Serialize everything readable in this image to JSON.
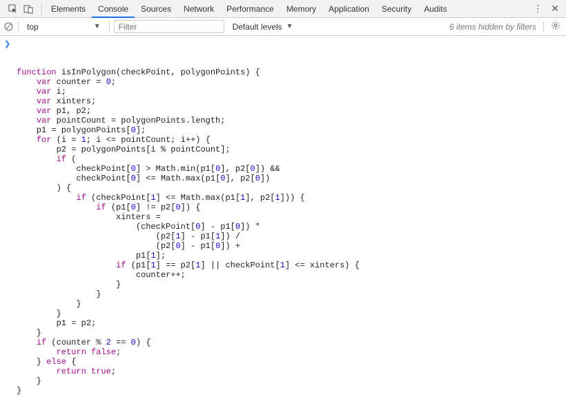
{
  "tabs": {
    "items": [
      {
        "label": "Elements"
      },
      {
        "label": "Console"
      },
      {
        "label": "Sources"
      },
      {
        "label": "Network"
      },
      {
        "label": "Performance"
      },
      {
        "label": "Memory"
      },
      {
        "label": "Application"
      },
      {
        "label": "Security"
      },
      {
        "label": "Audits"
      }
    ],
    "activeIndex": 1
  },
  "filterBar": {
    "context": "top",
    "filterPlaceholder": "Filter",
    "levels": "Default levels",
    "hidden": "6 items hidden by filters"
  },
  "code": {
    "lines": [
      [
        [
          "kw",
          "function"
        ],
        [
          "pun",
          " "
        ],
        [
          "fn",
          "isInPolygon"
        ],
        [
          "pun",
          "("
        ],
        [
          "fn",
          "checkPoint"
        ],
        [
          "pun",
          ", "
        ],
        [
          "fn",
          "polygonPoints"
        ],
        [
          "pun",
          ") {"
        ]
      ],
      [
        [
          "pun",
          "    "
        ],
        [
          "kw",
          "var"
        ],
        [
          "pun",
          " counter = "
        ],
        [
          "num",
          "0"
        ],
        [
          "pun",
          ";"
        ]
      ],
      [
        [
          "pun",
          "    "
        ],
        [
          "kw",
          "var"
        ],
        [
          "pun",
          " i;"
        ]
      ],
      [
        [
          "pun",
          "    "
        ],
        [
          "kw",
          "var"
        ],
        [
          "pun",
          " xinters;"
        ]
      ],
      [
        [
          "pun",
          "    "
        ],
        [
          "kw",
          "var"
        ],
        [
          "pun",
          " p1, p2;"
        ]
      ],
      [
        [
          "pun",
          "    "
        ],
        [
          "kw",
          "var"
        ],
        [
          "pun",
          " pointCount = polygonPoints.length;"
        ]
      ],
      [
        [
          "pun",
          "    p1 = polygonPoints["
        ],
        [
          "num",
          "0"
        ],
        [
          "pun",
          "];"
        ]
      ],
      [
        [
          "pun",
          ""
        ]
      ],
      [
        [
          "pun",
          "    "
        ],
        [
          "kw",
          "for"
        ],
        [
          "pun",
          " (i = "
        ],
        [
          "num",
          "1"
        ],
        [
          "pun",
          "; i <= pointCount; i++) {"
        ]
      ],
      [
        [
          "pun",
          "        p2 = polygonPoints[i % pointCount];"
        ]
      ],
      [
        [
          "pun",
          "        "
        ],
        [
          "kw",
          "if"
        ],
        [
          "pun",
          " ("
        ]
      ],
      [
        [
          "pun",
          "            checkPoint["
        ],
        [
          "num",
          "0"
        ],
        [
          "pun",
          "] > Math.min(p1["
        ],
        [
          "num",
          "0"
        ],
        [
          "pun",
          "], p2["
        ],
        [
          "num",
          "0"
        ],
        [
          "pun",
          "]) &&"
        ]
      ],
      [
        [
          "pun",
          "            checkPoint["
        ],
        [
          "num",
          "0"
        ],
        [
          "pun",
          "] <= Math.max(p1["
        ],
        [
          "num",
          "0"
        ],
        [
          "pun",
          "], p2["
        ],
        [
          "num",
          "0"
        ],
        [
          "pun",
          "])"
        ]
      ],
      [
        [
          "pun",
          "        ) {"
        ]
      ],
      [
        [
          "pun",
          "            "
        ],
        [
          "kw",
          "if"
        ],
        [
          "pun",
          " (checkPoint["
        ],
        [
          "num",
          "1"
        ],
        [
          "pun",
          "] <= Math.max(p1["
        ],
        [
          "num",
          "1"
        ],
        [
          "pun",
          "], p2["
        ],
        [
          "num",
          "1"
        ],
        [
          "pun",
          "])) {"
        ]
      ],
      [
        [
          "pun",
          "                "
        ],
        [
          "kw",
          "if"
        ],
        [
          "pun",
          " (p1["
        ],
        [
          "num",
          "0"
        ],
        [
          "pun",
          "] != p2["
        ],
        [
          "num",
          "0"
        ],
        [
          "pun",
          "]) {"
        ]
      ],
      [
        [
          "pun",
          "                    xinters ="
        ]
      ],
      [
        [
          "pun",
          "                        (checkPoint["
        ],
        [
          "num",
          "0"
        ],
        [
          "pun",
          "] - p1["
        ],
        [
          "num",
          "0"
        ],
        [
          "pun",
          "]) *"
        ]
      ],
      [
        [
          "pun",
          "                            (p2["
        ],
        [
          "num",
          "1"
        ],
        [
          "pun",
          "] - p1["
        ],
        [
          "num",
          "1"
        ],
        [
          "pun",
          "]) /"
        ]
      ],
      [
        [
          "pun",
          "                            (p2["
        ],
        [
          "num",
          "0"
        ],
        [
          "pun",
          "] - p1["
        ],
        [
          "num",
          "0"
        ],
        [
          "pun",
          "]) +"
        ]
      ],
      [
        [
          "pun",
          "                        p1["
        ],
        [
          "num",
          "1"
        ],
        [
          "pun",
          "];"
        ]
      ],
      [
        [
          "pun",
          "                    "
        ],
        [
          "kw",
          "if"
        ],
        [
          "pun",
          " (p1["
        ],
        [
          "num",
          "1"
        ],
        [
          "pun",
          "] == p2["
        ],
        [
          "num",
          "1"
        ],
        [
          "pun",
          "] || checkPoint["
        ],
        [
          "num",
          "1"
        ],
        [
          "pun",
          "] <= xinters) {"
        ]
      ],
      [
        [
          "pun",
          "                        counter++;"
        ]
      ],
      [
        [
          "pun",
          "                    }"
        ]
      ],
      [
        [
          "pun",
          "                }"
        ]
      ],
      [
        [
          "pun",
          "            }"
        ]
      ],
      [
        [
          "pun",
          "        }"
        ]
      ],
      [
        [
          "pun",
          "        p1 = p2;"
        ]
      ],
      [
        [
          "pun",
          "    }"
        ]
      ],
      [
        [
          "pun",
          "    "
        ],
        [
          "kw",
          "if"
        ],
        [
          "pun",
          " (counter % "
        ],
        [
          "num",
          "2"
        ],
        [
          "pun",
          " == "
        ],
        [
          "num",
          "0"
        ],
        [
          "pun",
          ") {"
        ]
      ],
      [
        [
          "pun",
          "        "
        ],
        [
          "kw",
          "return"
        ],
        [
          "pun",
          " "
        ],
        [
          "kw",
          "false"
        ],
        [
          "pun",
          ";"
        ]
      ],
      [
        [
          "pun",
          "    } "
        ],
        [
          "kw",
          "else"
        ],
        [
          "pun",
          " {"
        ]
      ],
      [
        [
          "pun",
          "        "
        ],
        [
          "kw",
          "return"
        ],
        [
          "pun",
          " "
        ],
        [
          "kw",
          "true"
        ],
        [
          "pun",
          ";"
        ]
      ],
      [
        [
          "pun",
          "    }"
        ]
      ],
      [
        [
          "pun",
          "}"
        ]
      ]
    ]
  }
}
